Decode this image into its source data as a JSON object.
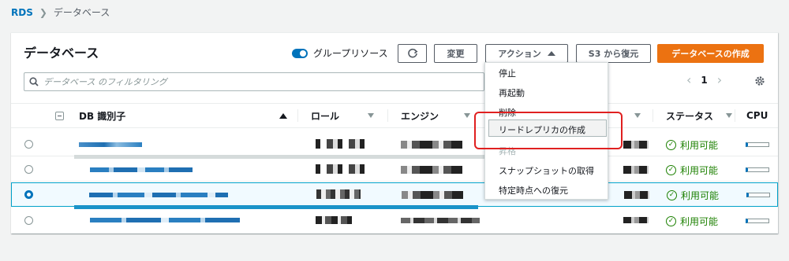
{
  "breadcrumb": {
    "root": "RDS",
    "current": "データベース"
  },
  "panel": {
    "title": "データベース",
    "group_toggle_label": "グループリソース",
    "buttons": {
      "modify": "変更",
      "actions": "アクション",
      "restore_s3": "S3 から復元",
      "create": "データベースの作成"
    },
    "search_placeholder": "データベース のフィルタリング",
    "page": "1"
  },
  "table": {
    "columns": [
      "DB 識別子",
      "ロール",
      "エンジン",
      "ステータス",
      "CPU"
    ],
    "status_text": "利用可能",
    "rows": [
      {
        "selected": false,
        "status": "利用可能"
      },
      {
        "selected": false,
        "status": "利用可能"
      },
      {
        "selected": true,
        "status": "利用可能"
      },
      {
        "selected": false,
        "status": "利用可能"
      }
    ]
  },
  "actions_menu": {
    "items": [
      {
        "label": "停止",
        "disabled": false
      },
      {
        "label": "再起動",
        "disabled": false
      },
      {
        "label": "削除",
        "disabled": false
      },
      {
        "label": "リードレプリカの作成",
        "disabled": false,
        "highlighted": true
      },
      {
        "label": "昇格",
        "disabled": true
      },
      {
        "label": "スナップショットの取得",
        "disabled": false
      },
      {
        "label": "特定時点への復元",
        "disabled": false
      }
    ]
  },
  "colors": {
    "accent": "#0073bb",
    "primary": "#ec7211",
    "success": "#1d8102",
    "highlight_box": "#e02020"
  }
}
